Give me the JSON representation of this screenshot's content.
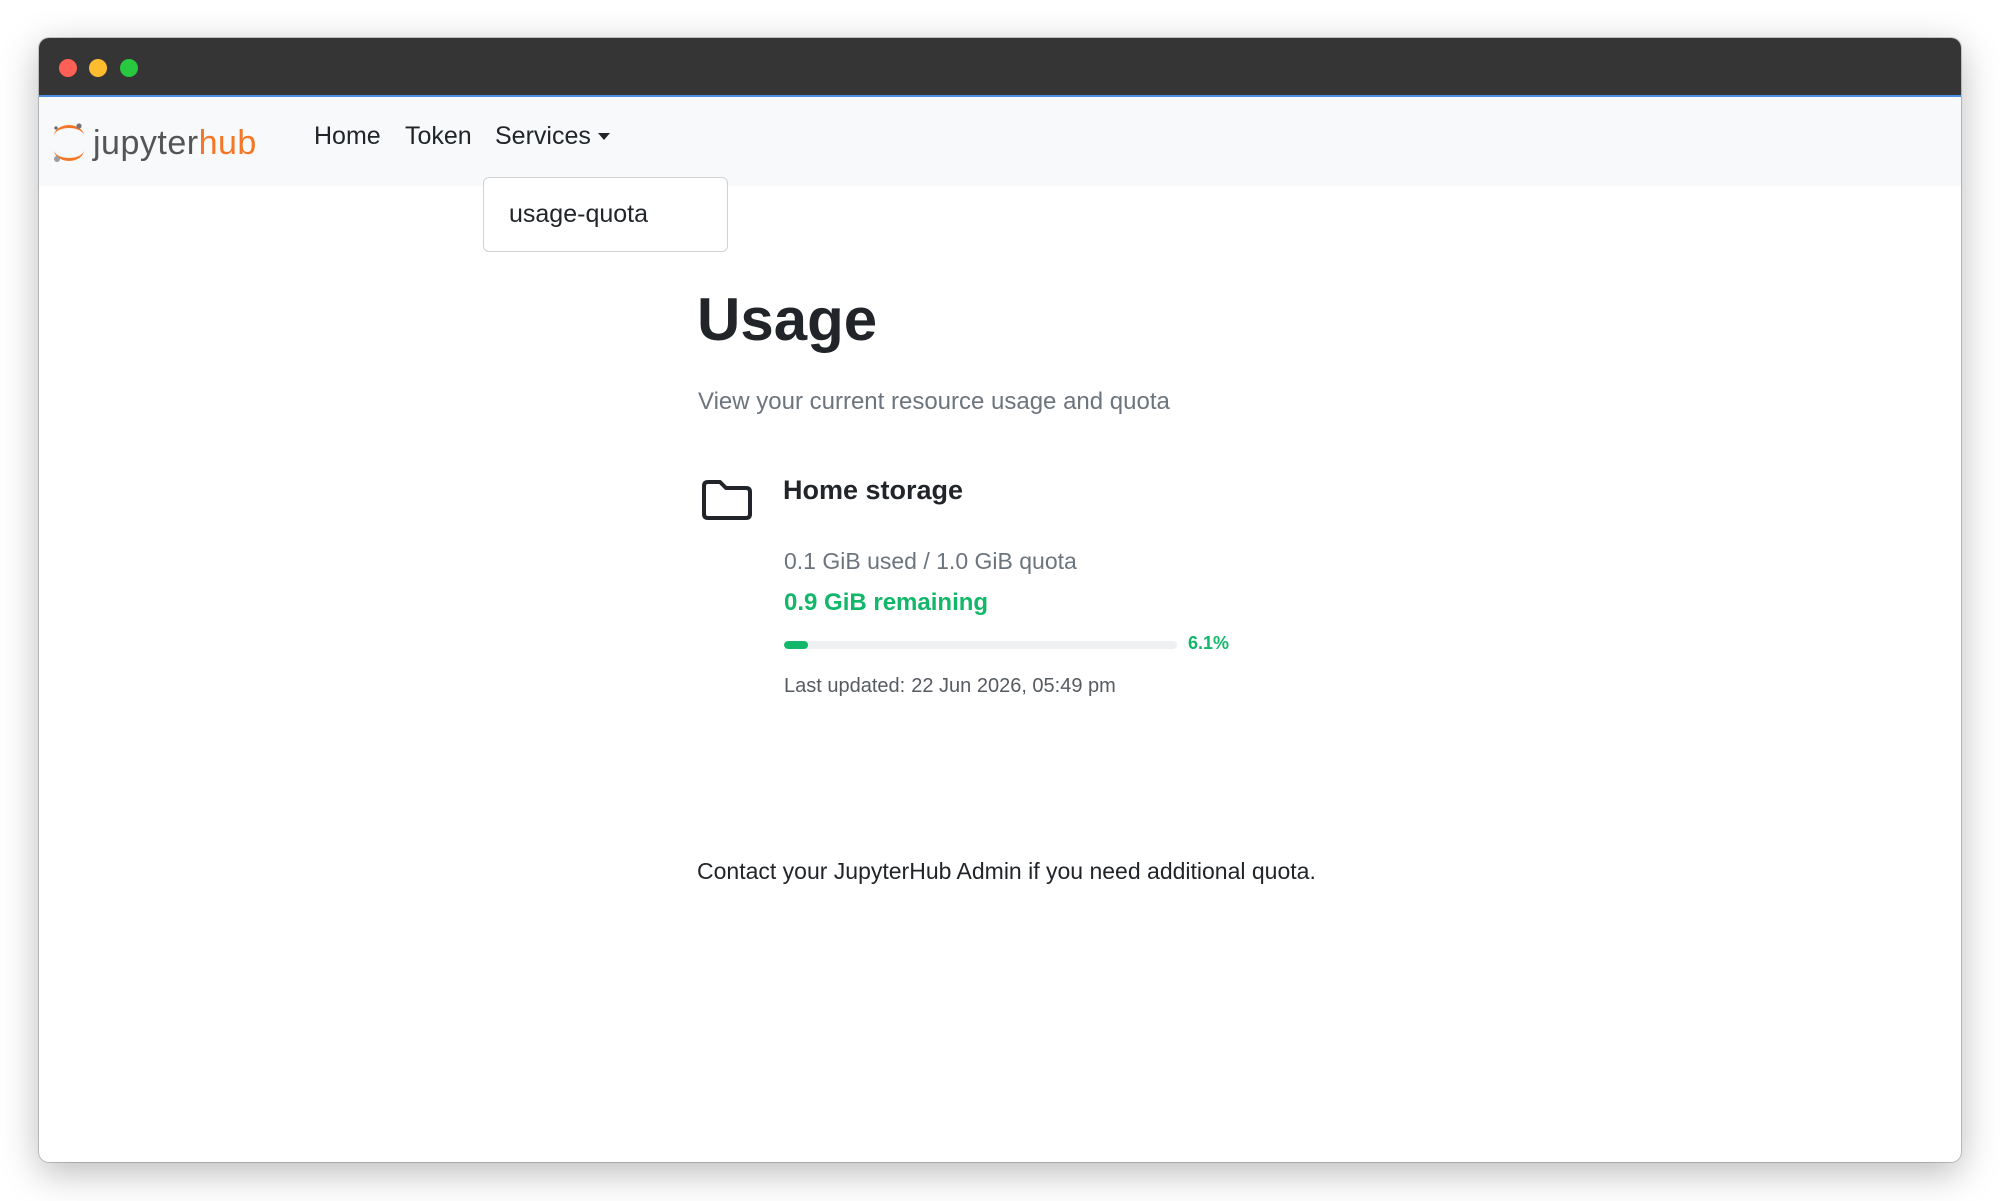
{
  "brand": {
    "part1": "jupyter",
    "part2": "hub"
  },
  "nav": {
    "home": "Home",
    "token": "Token",
    "services": "Services",
    "services_menu": [
      "usage-quota"
    ]
  },
  "page": {
    "title": "Usage",
    "subtitle": "View your current resource usage and quota"
  },
  "storage": {
    "title": "Home storage",
    "usage": "0.1 GiB used / 1.0 GiB quota",
    "remaining": "0.9 GiB remaining",
    "percent_label": "6.1%",
    "percent_value": 6.1,
    "last_updated_label": "Last updated:",
    "last_updated": "22 Jun 2026, 05:49 pm",
    "icon": "folder-icon"
  },
  "footer": {
    "contact": "Contact your JupyterHub Admin if you need additional quota."
  },
  "colors": {
    "accent": "#12b76a",
    "brand_orange": "#f37726",
    "navbar_bg": "#f8f9fa"
  }
}
